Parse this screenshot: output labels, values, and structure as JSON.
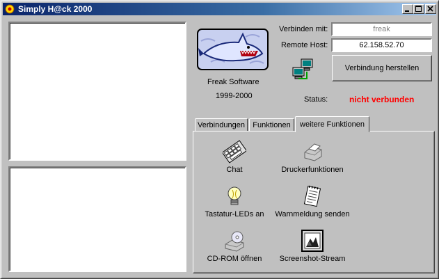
{
  "window": {
    "title": "Simply H@ck 2000"
  },
  "branding": {
    "company": "Freak Software",
    "years": "1999-2000"
  },
  "connection": {
    "connect_with_label": "Verbinden mit:",
    "connect_with_value": "freak",
    "remote_host_label": "Remote Host:",
    "remote_host_value": "62.158.52.70",
    "connect_button": "Verbindung herstellen",
    "status_label": "Status:",
    "status_value": "nicht verbunden",
    "status_color": "#ff0000"
  },
  "tabs": [
    {
      "label": "Verbindungen",
      "active": false
    },
    {
      "label": "Funktionen",
      "active": false
    },
    {
      "label": "weitere Funktionen",
      "active": true
    }
  ],
  "functions": [
    {
      "label": "Chat",
      "icon": "keyboard-icon"
    },
    {
      "label": "Druckerfunktionen",
      "icon": "printer-icon"
    },
    {
      "label": "Tastatur-LEDs an",
      "icon": "lightbulb-icon"
    },
    {
      "label": "Warnmeldung senden",
      "icon": "notepad-icon"
    },
    {
      "label": "CD-ROM öffnen",
      "icon": "cdrom-icon"
    },
    {
      "label": "Screenshot-Stream",
      "icon": "picture-icon"
    }
  ]
}
